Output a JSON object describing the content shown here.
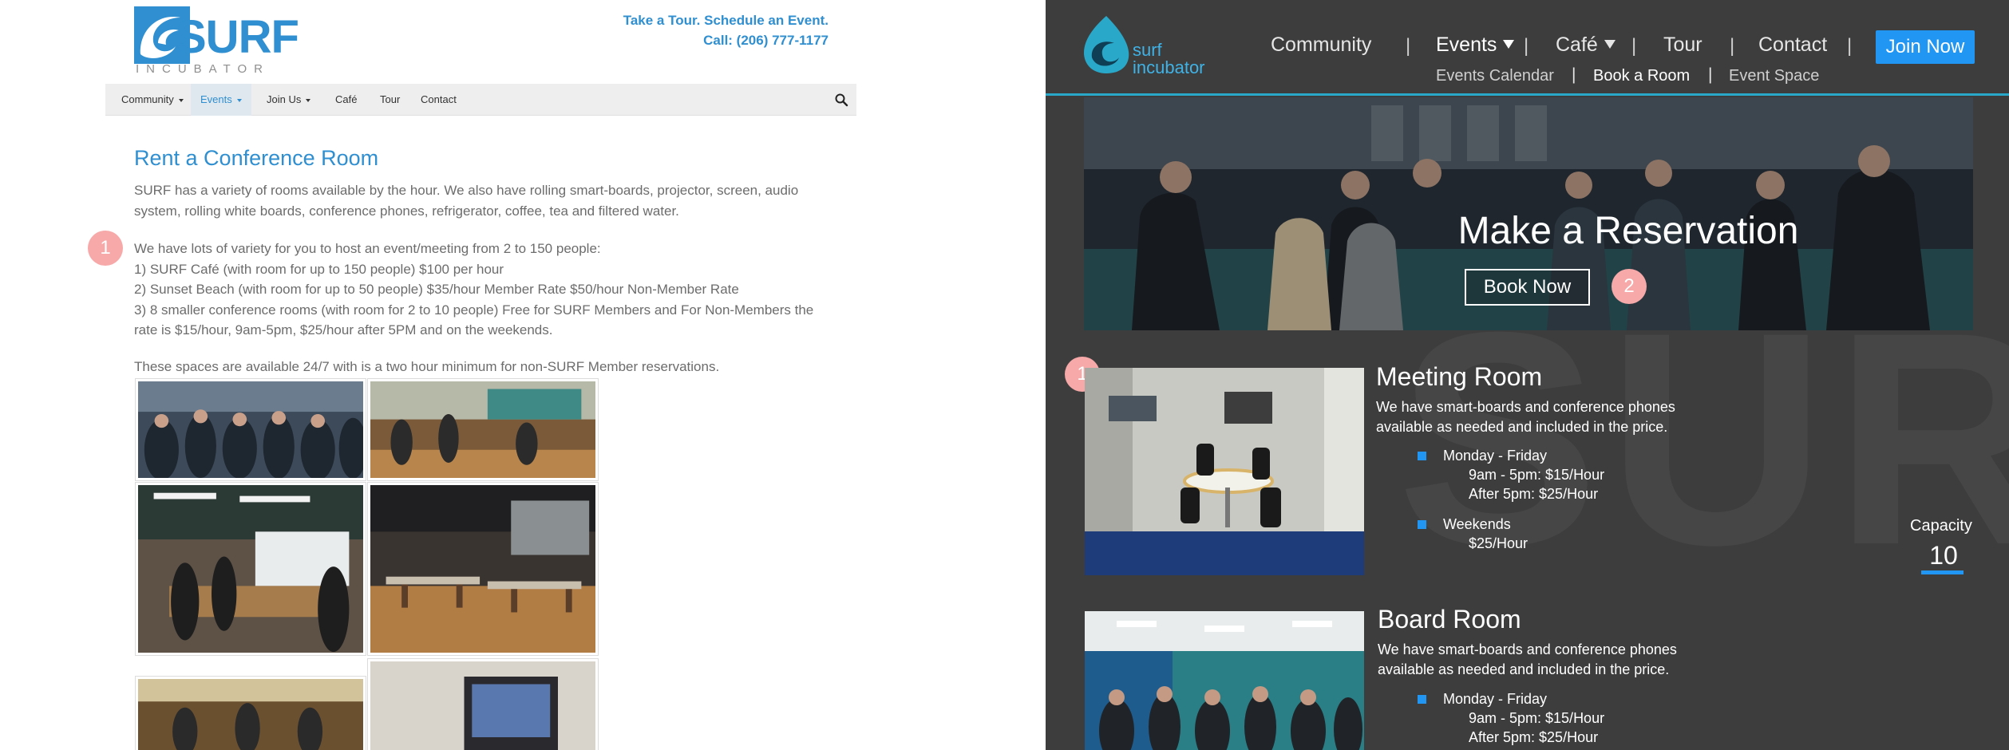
{
  "left_mockup": {
    "logo": {
      "word": "SURF",
      "sub": "INCUBATOR",
      "icon": "surf-wave-logo"
    },
    "header": {
      "tagline": "Take a Tour. Schedule an Event.",
      "phone": "Call: (206) 777-1177"
    },
    "nav": {
      "items": [
        {
          "label": "Community",
          "dropdown": true
        },
        {
          "label": "Events",
          "dropdown": true,
          "active": true
        },
        {
          "label": "Join Us",
          "dropdown": true
        },
        {
          "label": "Café"
        },
        {
          "label": "Tour"
        },
        {
          "label": "Contact"
        }
      ],
      "search_icon": "search-icon"
    },
    "title": "Rent a Conference Room",
    "intro": "SURF has a variety of rooms available by the hour. We also have rolling smart-boards, projector, screen, audio system, rolling white boards, conference phones, refrigerator, coffee, tea and filtered water.",
    "variety": {
      "lead": "We have lots of variety for you to host an event/meeting from 2 to 150 people:",
      "items": [
        "1) SURF Café (with room for up to 150 people) $100 per hour",
        "2) Sunset Beach (with room for up to 50 people) $35/hour Member Rate $50/hour Non-Member Rate",
        "3) 8 smaller conference rooms (with room for 2 to 10 people) Free for SURF Members and For Non-Members the rate is $15/hour, 9am-5pm, $25/hour after 5PM and on the weekends."
      ]
    },
    "availability": "These spaces are available 24/7 with is a two hour minimum for non-SURF Member reservations.",
    "marker": "1"
  },
  "right_mockup": {
    "logo": {
      "line1": "surf",
      "line2": "incubator"
    },
    "nav": {
      "items": [
        {
          "label": "Community"
        },
        {
          "label": "Events",
          "dropdown": true,
          "active": true
        },
        {
          "label": "Café",
          "dropdown": true
        },
        {
          "label": "Tour"
        },
        {
          "label": "Contact"
        }
      ],
      "separator": "|",
      "join": "Join Now"
    },
    "sub_nav": {
      "items": [
        {
          "label": "Events Calendar"
        },
        {
          "label": "Book a Room",
          "active": true
        },
        {
          "label": "Event Space"
        }
      ],
      "separator": "|"
    },
    "hero": {
      "title": "Make a Reservation",
      "button": "Book Now",
      "marker": "2"
    },
    "watermark": "SURF",
    "rooms": [
      {
        "title": "Meeting Room",
        "description": "We have smart-boards and conference phones available as needed and included in the price.",
        "schedule": [
          {
            "days": "Monday - Friday",
            "lines": [
              "9am - 5pm: $15/Hour",
              "After 5pm:  $25/Hour"
            ]
          },
          {
            "days": "Weekends",
            "lines": [
              "$25/Hour"
            ]
          }
        ],
        "capacity_label": "Capacity",
        "capacity": "10",
        "marker": "1"
      },
      {
        "title": "Board Room",
        "description": "We have smart-boards and conference phones available as needed and included in the price.",
        "schedule": [
          {
            "days": "Monday - Friday",
            "lines": [
              "9am - 5pm: $15/Hour",
              "After 5pm:  $25/Hour"
            ]
          }
        ]
      }
    ]
  },
  "colors": {
    "brand_blue": "#2f8fd0",
    "accent_blue": "#2196f3",
    "teal_line": "#2aa8c9",
    "dark_bg": "#3d3d3d",
    "marker_pink": "#f7a8a8"
  }
}
